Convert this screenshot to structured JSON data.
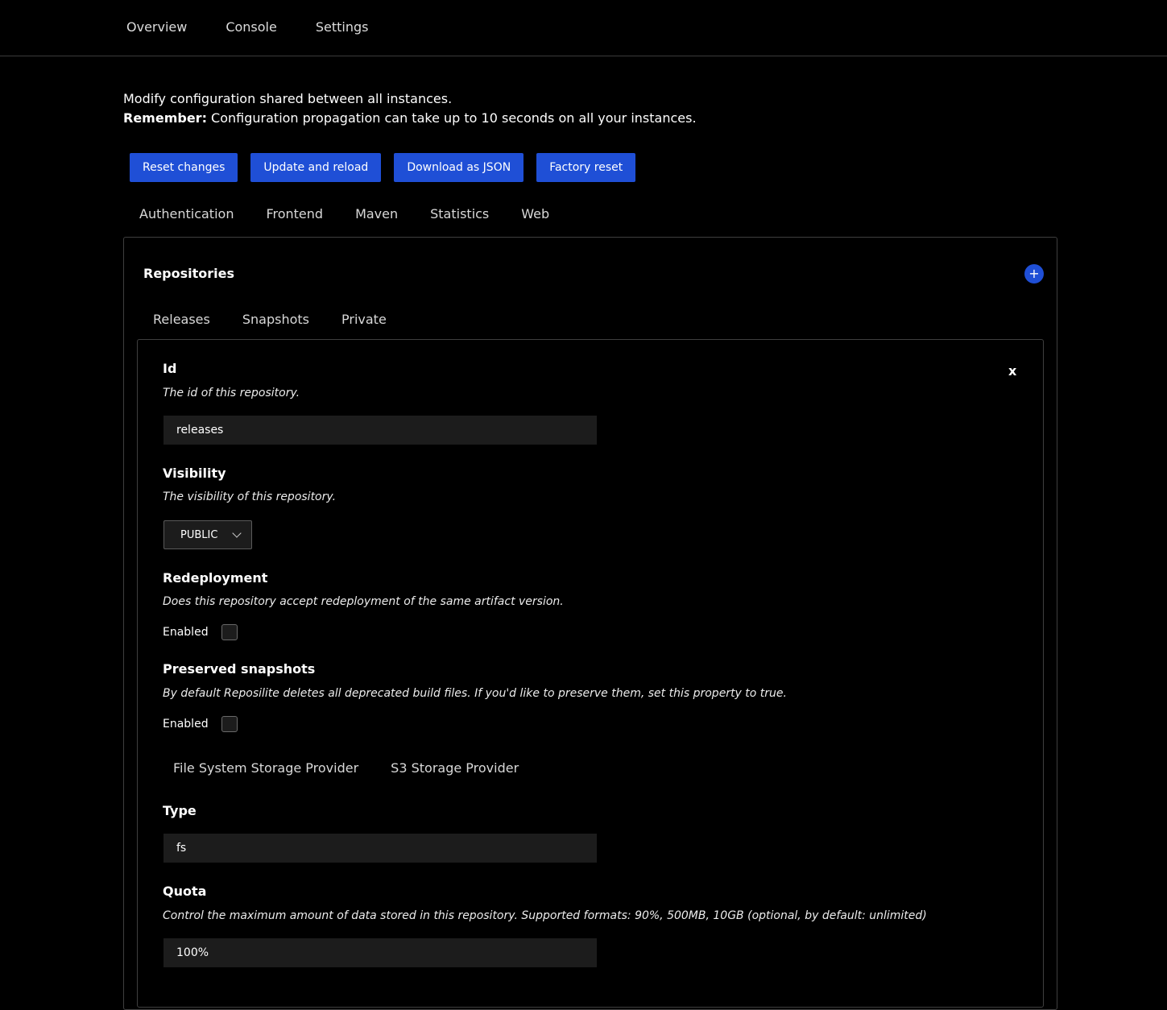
{
  "topnav": {
    "items": [
      {
        "label": "Overview"
      },
      {
        "label": "Console"
      },
      {
        "label": "Settings"
      }
    ]
  },
  "intro": {
    "line1": "Modify configuration shared between all instances.",
    "remember_label": "Remember:",
    "remember_text": " Configuration propagation can take up to 10 seconds on all your instances."
  },
  "actions": {
    "reset_changes": "Reset changes",
    "update_reload": "Update and reload",
    "download_json": "Download as JSON",
    "factory_reset": "Factory reset"
  },
  "main_tabs": [
    {
      "label": "Authentication"
    },
    {
      "label": "Frontend"
    },
    {
      "label": "Maven"
    },
    {
      "label": "Statistics"
    },
    {
      "label": "Web"
    }
  ],
  "repositories": {
    "title": "Repositories",
    "add_icon": "plus-icon",
    "add_label": "+",
    "tabs": [
      {
        "label": "Releases"
      },
      {
        "label": "Snapshots"
      },
      {
        "label": "Private"
      }
    ],
    "card": {
      "close_label": "x",
      "id": {
        "label": "Id",
        "description": "The id of this repository.",
        "value": "releases"
      },
      "visibility": {
        "label": "Visibility",
        "description": "The visibility of this repository.",
        "value": "PUBLIC",
        "icon": "chevron-down-icon"
      },
      "redeployment": {
        "label": "Redeployment",
        "description": "Does this repository accept redeployment of the same artifact version.",
        "checkbox_label": "Enabled",
        "checked": false
      },
      "preserved_snapshots": {
        "label": "Preserved snapshots",
        "description": "By default Reposilite deletes all deprecated build files. If you'd like to preserve them, set this property to true.",
        "checkbox_label": "Enabled",
        "checked": false
      },
      "storage_tabs": [
        {
          "label": "File System Storage Provider"
        },
        {
          "label": "S3 Storage Provider"
        }
      ],
      "type": {
        "label": "Type",
        "value": "fs"
      },
      "quota": {
        "label": "Quota",
        "description": "Control the maximum amount of data stored in this repository. Supported formats: 90%, 500MB, 10GB (optional, by default: unlimited)",
        "value": "100%"
      }
    }
  },
  "colors": {
    "accent": "#1f4fd6",
    "background": "#000000",
    "input_bg": "#1c1c1c",
    "border": "#3f3f3f"
  }
}
